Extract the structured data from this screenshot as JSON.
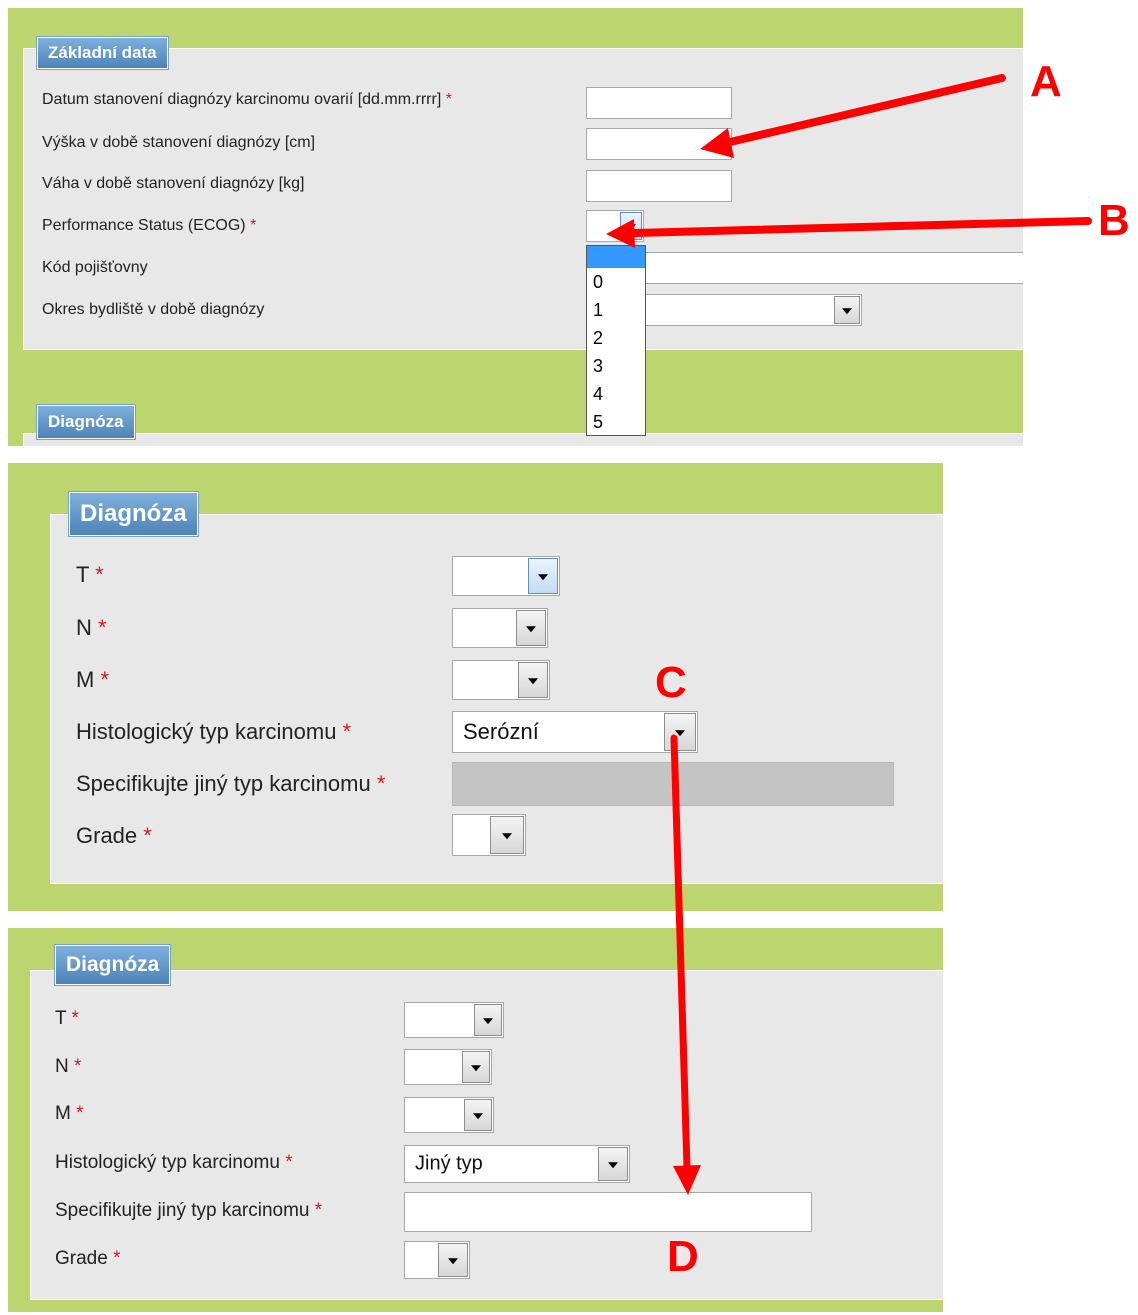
{
  "form1": {
    "legend": "Základní data",
    "fields": {
      "date_label": "Datum stanovení diagnózy karcinomu ovarií [dd.mm.rrrr]",
      "height_label": "Výška v době stanovení diagnózy [cm]",
      "weight_label": "Váha v době stanovení diagnózy [kg]",
      "ecog_label": "Performance Status (ECOG)",
      "insurance_label": "Kód pojišťovny",
      "district_label": "Okres bydliště v době diagnózy"
    },
    "required_mark": "*",
    "ecog_options": [
      "0",
      "1",
      "2",
      "3",
      "4",
      "5"
    ],
    "next_legend": "Diagnóza"
  },
  "form2": {
    "legend": "Diagnóza",
    "t_label": "T",
    "n_label": "N",
    "m_label": "M",
    "histo_label": "Histologický typ karcinomu",
    "histo_value": "Serózní",
    "specify_label": "Specifikujte jiný typ karcinomu",
    "grade_label": "Grade",
    "required_mark": "*"
  },
  "form3": {
    "legend": "Diagnóza",
    "t_label": "T",
    "n_label": "N",
    "m_label": "M",
    "histo_label": "Histologický typ karcinomu",
    "histo_value": "Jiný typ",
    "specify_label": "Specifikujte jiný typ karcinomu",
    "grade_label": "Grade",
    "required_mark": "*"
  },
  "callouts": {
    "a": "A",
    "b": "B",
    "c": "C",
    "d": "D"
  },
  "colors": {
    "panel_green": "#bdd56e",
    "inner_gray": "#e8e8e8",
    "legend_blue": "#5b8fc4",
    "required_red": "#d11b1b",
    "annotation_red": "#ff0000",
    "selection_blue": "#3399ff"
  }
}
